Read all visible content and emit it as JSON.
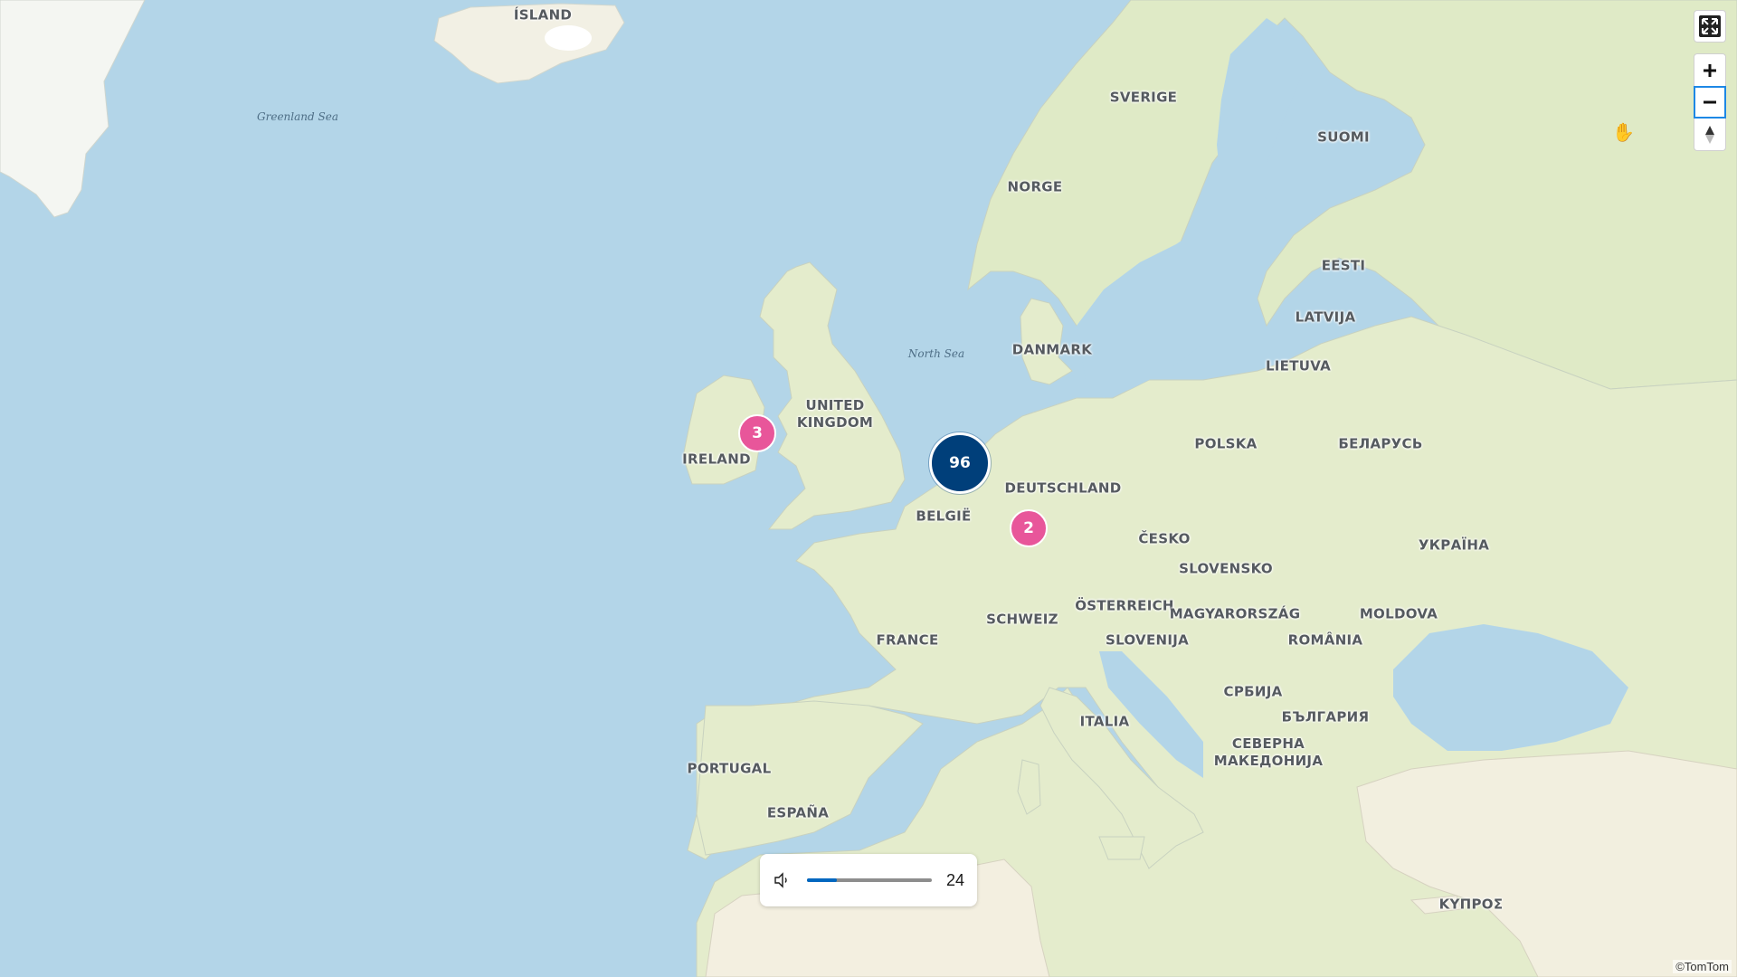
{
  "map": {
    "country_labels": {
      "island": "ÍSLAND",
      "sverige": "SVERIGE",
      "suomi": "SUOMI",
      "norge": "NORGE",
      "eesti": "EESTI",
      "latvija": "LATVIJA",
      "lietuva": "LIETUVA",
      "danmark": "DANMARK",
      "united_kingdom": "UNITED\nKINGDOM",
      "ireland": "IRELAND",
      "polska": "POLSKA",
      "belarus": "БЕЛАРУСЬ",
      "deutschland": "DEUTSCHLAND",
      "belgie": "BELGIË",
      "cesko": "ČESKO",
      "ukraina": "УКРАЇНА",
      "slovensko": "SLOVENSKO",
      "osterreich": "ÖSTERREICH",
      "schweiz": "SCHWEIZ",
      "magyarorszag": "MAGYARORSZÁG",
      "moldova": "MOLDOVA",
      "france": "FRANCE",
      "slovenija": "SLOVENIJA",
      "romania": "ROMÂNIA",
      "srbija": "СРБИЈА",
      "bulgaria": "БЪЛГАРИЯ",
      "italia": "ITALIA",
      "north_macedonia": "СЕВЕРНА\nМАКЕДОНИЈА",
      "portugal": "PORTUGAL",
      "espana": "ESPAÑA",
      "kypros": "ΚΥΠΡΟΣ"
    },
    "sea_labels": {
      "greenland_sea": "Greenland Sea",
      "north_sea": "North Sea"
    },
    "clusters": {
      "benelux": "96",
      "ireland": "3",
      "germany": "2"
    },
    "colors": {
      "water": "#b3d5e8",
      "land": "#e4eccc",
      "cluster_large": "#003f7a",
      "cluster_small": "#e8569a",
      "active_control": "#1e88e5"
    },
    "attribution": "©TomTom"
  },
  "controls": {
    "fullscreen_icon": "fullscreen-icon",
    "zoom_in_icon": "plus-icon",
    "zoom_out_icon": "minus-icon",
    "compass_icon": "compass-icon"
  },
  "volume": {
    "icon": "speaker-icon",
    "level_percent": 24,
    "value": "24"
  }
}
